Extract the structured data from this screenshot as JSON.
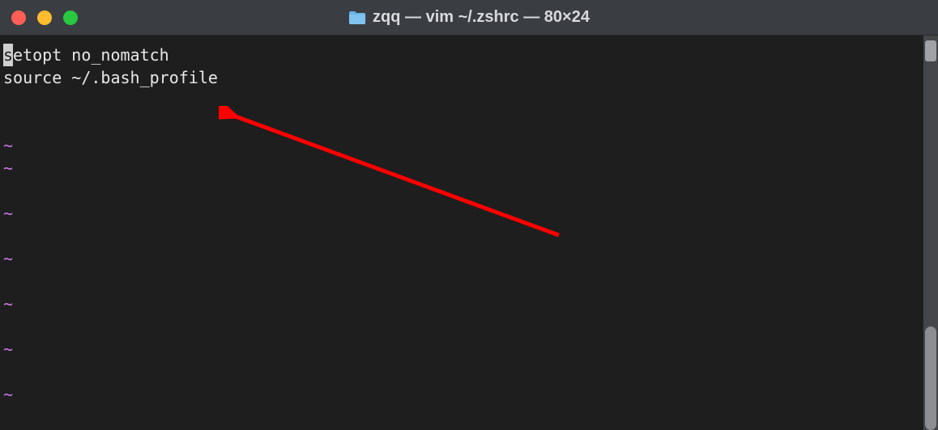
{
  "window": {
    "title": "zqq — vim ~/.zshrc — 80×24"
  },
  "editor": {
    "cursor_char": "s",
    "line1_rest": "etopt no_nomatch",
    "line2": "source ~/.bash_profile",
    "tilde": "~"
  },
  "colors": {
    "traffic_red": "#ff5f57",
    "traffic_yellow": "#febc2e",
    "traffic_green": "#28c840",
    "tilde_color": "#c778dd",
    "arrow_color": "#ff0000",
    "bg": "#1e1e1e",
    "titlebar_bg": "#3a3d42",
    "text": "#e8e8e8"
  }
}
